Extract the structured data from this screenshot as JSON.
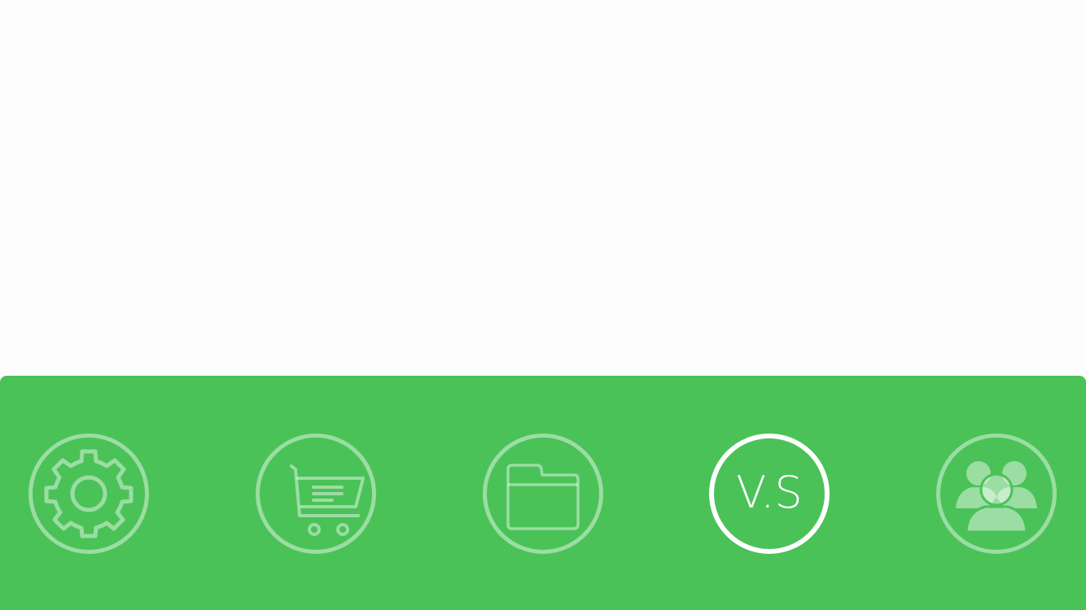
{
  "tab_bar": {
    "background_color": "#4ac258",
    "tabs": [
      {
        "name": "settings",
        "icon": "gear-icon",
        "active": false
      },
      {
        "name": "cart",
        "icon": "shopping-cart-icon",
        "active": false
      },
      {
        "name": "folder",
        "icon": "folder-icon",
        "active": false
      },
      {
        "name": "vs",
        "label": "V.S",
        "active": true
      },
      {
        "name": "users",
        "icon": "group-users-icon",
        "active": false
      }
    ]
  }
}
